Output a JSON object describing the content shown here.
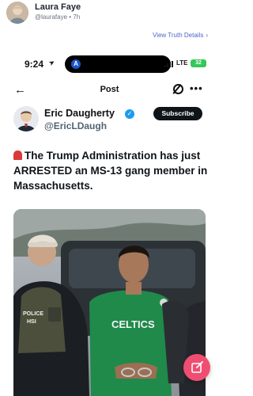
{
  "outer_post": {
    "author_name": "Laura Faye",
    "author_meta": "@laurafaye • 7h",
    "view_details_label": "View Truth Details",
    "view_details_icon": "chevron-right-icon"
  },
  "screenshot": {
    "status_bar": {
      "time": "9:24",
      "island_app_letter": "A",
      "network": "LTE",
      "battery": "32"
    },
    "nav": {
      "back_icon": "arrow-left-icon",
      "title": "Post",
      "grok_icon": "grok-icon",
      "more_icon": "more-icon"
    },
    "author": {
      "name": "Eric Daugherty",
      "handle": "@EricLDaugh",
      "subscribe_label": "Subscribe"
    },
    "post_text": "The Trump Administration has just ARRESTED an MS-13 gang member in Massachusetts.",
    "media": {
      "vest_line1": "POLICE",
      "vest_line2": "HSI",
      "shirt_text": "CELTICS"
    }
  },
  "fab": {
    "icon": "compose-icon"
  },
  "colors": {
    "link": "#4f63c8",
    "fab": "#ef4e72",
    "verified": "#1d9bf0",
    "battery": "#34c759"
  }
}
